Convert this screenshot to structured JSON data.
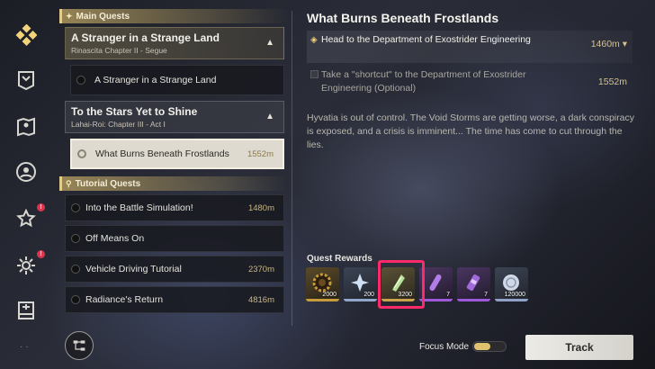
{
  "rail": {
    "icons": [
      "diamond-menu-icon",
      "banner-icon",
      "map-icon",
      "profile-icon",
      "star-icon",
      "settings-icon",
      "archive-icon"
    ],
    "alert_mark": "!"
  },
  "main_quests": {
    "header": "Main Quests",
    "groups": [
      {
        "title": "A Stranger in a Strange Land",
        "subtitle": "Rinascita Chapter II - Segue",
        "items": [
          {
            "name": "A Stranger in a Strange Land",
            "distance": ""
          }
        ]
      },
      {
        "title": "To the Stars Yet to Shine",
        "subtitle": "Lahai-Roi: Chapter III - Act I",
        "items": [
          {
            "name": "What Burns Beneath Frostlands",
            "distance": "1552m",
            "selected": true
          }
        ]
      }
    ]
  },
  "tutorial_quests": {
    "header": "Tutorial Quests",
    "items": [
      {
        "name": "Into the Battle Simulation!",
        "distance": "1480m"
      },
      {
        "name": "Off Means On",
        "distance": ""
      },
      {
        "name": "Vehicle Driving Tutorial",
        "distance": "2370m"
      },
      {
        "name": "Radiance's Return",
        "distance": "4816m"
      }
    ]
  },
  "detail": {
    "title": "What Burns Beneath Frostlands",
    "objectives": [
      {
        "text": "Head to the Department of Exostrider Engineering",
        "distance": "1460m ▾",
        "active": true
      },
      {
        "text": "Take a \"shortcut\" to the Department of Exostrider Engineering (Optional)",
        "distance": "1552m",
        "active": false
      }
    ],
    "description": "Hyvatia is out of control. The Void Storms are getting worse, a dark conspiracy is exposed, and a crisis is imminent... The time has come to cut through the lies."
  },
  "rewards": {
    "label": "Quest Rewards",
    "items": [
      {
        "icon": "gear-coin-icon",
        "count": "2000",
        "color": "#c79a3a"
      },
      {
        "icon": "crystal-icon",
        "count": "200",
        "color": "#8fa8c9"
      },
      {
        "icon": "green-crystal-icon",
        "count": "3200",
        "color": "#c9a24a"
      },
      {
        "icon": "purple-capsule-icon",
        "count": "7",
        "color": "#9c5ad8"
      },
      {
        "icon": "purple-canister-icon",
        "count": "7",
        "color": "#9c5ad8"
      },
      {
        "icon": "shell-credit-icon",
        "count": "120000",
        "color": "#8fa0c9"
      }
    ]
  },
  "footer": {
    "focus_mode_label": "Focus Mode",
    "focus_mode_on": true,
    "track_label": "Track"
  }
}
